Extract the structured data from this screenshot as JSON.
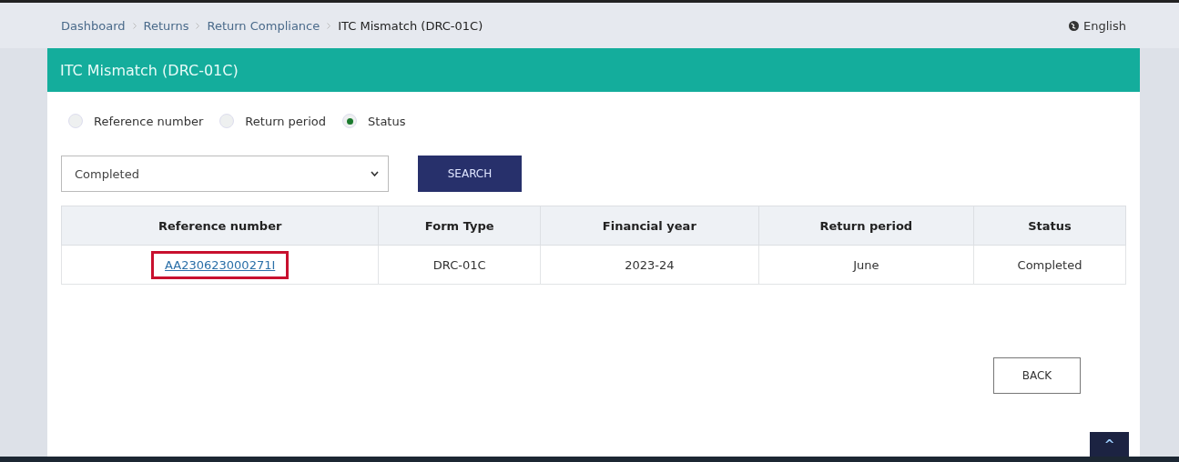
{
  "breadcrumb": [
    {
      "label": "Dashboard",
      "current": false
    },
    {
      "label": "Returns",
      "current": false
    },
    {
      "label": "Return Compliance",
      "current": false
    },
    {
      "label": "ITC Mismatch (DRC-01C)",
      "current": true
    }
  ],
  "language": "English",
  "panel_title": "ITC Mismatch (DRC-01C)",
  "search_by": [
    {
      "label": "Reference number",
      "selected": false
    },
    {
      "label": "Return period",
      "selected": false
    },
    {
      "label": "Status",
      "selected": true
    }
  ],
  "status_select": {
    "value": "Completed"
  },
  "search_button": "SEARCH",
  "table": {
    "columns": [
      "Reference number",
      "Form Type",
      "Financial year",
      "Return period",
      "Status"
    ],
    "rows": [
      {
        "reference": "AA230623000271I",
        "highlighted": true,
        "form_type": "DRC-01C",
        "financial_year": "2023-24",
        "return_period": "June",
        "status": "Completed"
      }
    ]
  },
  "back_button": "BACK",
  "scroll_top_button": "^"
}
